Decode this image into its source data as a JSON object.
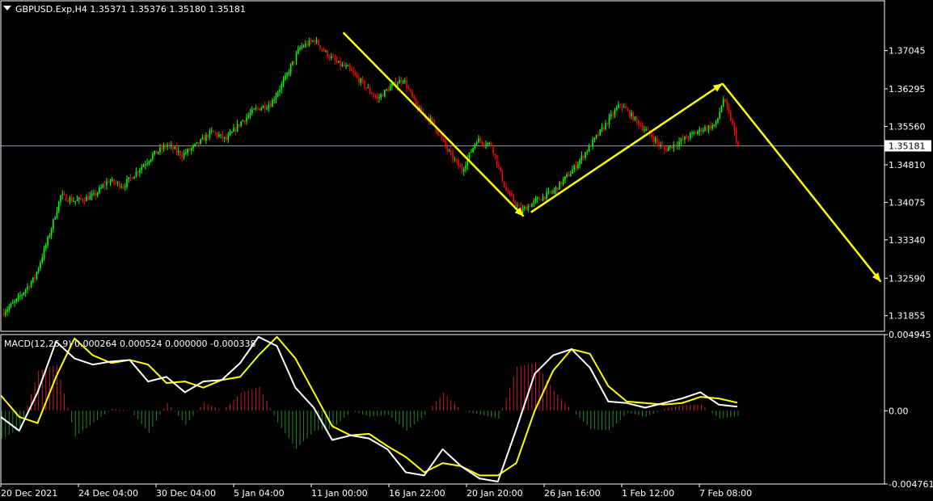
{
  "header": {
    "symbol_line": "GBPUSD.Exp,H4  1.35371 1.35376 1.35180 1.35181",
    "dropdown_icon": "triangle-down-icon"
  },
  "colors": {
    "background": "#000000",
    "bull": "#00ff00",
    "bear": "#ff0000",
    "arrow": "#ffff00",
    "macd": "#ffffff",
    "signal": "#ffff00",
    "hist_pos": "#c81e1e",
    "hist_neg": "#1e8c1e",
    "frame": "#ffffff"
  },
  "chart_data": [
    {
      "type": "candlestick",
      "title": "GBPUSD.Exp,H4",
      "ohlc_last": {
        "open": 1.35371,
        "high": 1.35376,
        "low": 1.3518,
        "close": 1.35181
      },
      "current_price_label": "1.35181",
      "ylim": [
        1.3155,
        1.3802
      ],
      "y_ticks": [
        "1.37045",
        "1.36295",
        "1.35560",
        "1.34810",
        "1.34075",
        "1.33340",
        "1.32590",
        "1.31855"
      ],
      "x_ticks": [
        "20 Dec 2021",
        "24 Dec 04:00",
        "30 Dec 04:00",
        "5 Jan 04:00",
        "11 Jan 00:00",
        "16 Jan 22:00",
        "20 Jan 20:00",
        "26 Jan 16:00",
        "1 Feb 12:00",
        "7 Feb 08:00"
      ],
      "close_path": [
        [
          0,
          1.319
        ],
        [
          8,
          1.3215
        ],
        [
          18,
          1.326
        ],
        [
          26,
          1.3345
        ],
        [
          32,
          1.342
        ],
        [
          40,
          1.341
        ],
        [
          50,
          1.342
        ],
        [
          58,
          1.345
        ],
        [
          66,
          1.344
        ],
        [
          74,
          1.347
        ],
        [
          82,
          1.35
        ],
        [
          90,
          1.352
        ],
        [
          98,
          1.35
        ],
        [
          106,
          1.352
        ],
        [
          114,
          1.3545
        ],
        [
          122,
          1.353
        ],
        [
          130,
          1.3565
        ],
        [
          138,
          1.359
        ],
        [
          146,
          1.36
        ],
        [
          154,
          1.365
        ],
        [
          162,
          1.371
        ],
        [
          170,
          1.3725
        ],
        [
          176,
          1.37
        ],
        [
          182,
          1.368
        ],
        [
          188,
          1.367
        ],
        [
          196,
          1.364
        ],
        [
          204,
          1.361
        ],
        [
          210,
          1.363
        ],
        [
          218,
          1.365
        ],
        [
          226,
          1.359
        ],
        [
          234,
          1.3565
        ],
        [
          242,
          1.351
        ],
        [
          250,
          1.347
        ],
        [
          258,
          1.353
        ],
        [
          266,
          1.352
        ],
        [
          274,
          1.343
        ],
        [
          282,
          1.339
        ],
        [
          290,
          1.341
        ],
        [
          300,
          1.343
        ],
        [
          310,
          1.347
        ],
        [
          320,
          1.352
        ],
        [
          328,
          1.356
        ],
        [
          336,
          1.36
        ],
        [
          344,
          1.357
        ],
        [
          352,
          1.354
        ],
        [
          360,
          1.351
        ],
        [
          370,
          1.353
        ],
        [
          380,
          1.355
        ],
        [
          388,
          1.356
        ],
        [
          392,
          1.361
        ],
        [
          396,
          1.357
        ],
        [
          400,
          1.3518
        ]
      ],
      "annotations": [
        {
          "type": "arrow",
          "from": [
            186,
            1.374
          ],
          "to": [
            284,
            1.338
          ]
        },
        {
          "type": "arrow",
          "from": [
            288,
            1.3388
          ],
          "to": [
            392,
            1.364
          ]
        },
        {
          "type": "arrow",
          "from": [
            392,
            1.364
          ],
          "to": [
            478,
            1.3252
          ]
        }
      ]
    },
    {
      "type": "line",
      "title": "MACD(12,26,9) 0.000264 0.000524 0.000000 -0.000338",
      "ylim": [
        -0.00476,
        0.00495
      ],
      "y_ticks": [
        "0.004945",
        "0.00",
        "-0.004761"
      ],
      "series": [
        {
          "name": "MACD",
          "x": [
            0,
            10,
            20,
            30,
            40,
            50,
            60,
            70,
            80,
            90,
            100,
            110,
            120,
            130,
            140,
            150,
            160,
            170,
            180,
            190,
            200,
            210,
            220,
            230,
            240,
            250,
            260,
            270,
            280,
            290,
            300,
            310,
            320,
            330,
            340,
            350,
            360,
            370,
            380,
            390,
            400
          ],
          "values": [
            -0.0004,
            -0.0013,
            0.0012,
            0.0045,
            0.0034,
            0.003,
            0.0032,
            0.0033,
            0.0019,
            0.0022,
            0.0012,
            0.0019,
            0.002,
            0.0031,
            0.0048,
            0.0042,
            0.0015,
            0.0002,
            -0.0019,
            -0.0016,
            -0.0018,
            -0.0025,
            -0.004,
            -0.0042,
            -0.0025,
            -0.0036,
            -0.0044,
            -0.0046,
            -0.0012,
            0.0024,
            0.0036,
            0.004,
            0.0028,
            0.0006,
            0.0005,
            0.0002,
            0.0005,
            0.0008,
            0.0012,
            0.0004,
            0.000264
          ]
        },
        {
          "name": "Signal",
          "x": [
            0,
            10,
            20,
            30,
            40,
            50,
            60,
            70,
            80,
            90,
            100,
            110,
            120,
            130,
            140,
            150,
            160,
            170,
            180,
            190,
            200,
            210,
            220,
            230,
            240,
            250,
            260,
            270,
            280,
            290,
            300,
            310,
            320,
            330,
            340,
            350,
            360,
            370,
            380,
            390,
            400
          ],
          "values": [
            0.001,
            -0.0004,
            -0.0008,
            0.0022,
            0.0047,
            0.0036,
            0.0031,
            0.0033,
            0.003,
            0.0018,
            0.0019,
            0.0015,
            0.002,
            0.0022,
            0.0036,
            0.0048,
            0.0034,
            0.0012,
            -0.001,
            -0.0016,
            -0.0015,
            -0.0023,
            -0.003,
            -0.004,
            -0.0034,
            -0.0036,
            -0.0042,
            -0.0042,
            -0.0034,
            0.0,
            0.0026,
            0.004,
            0.0037,
            0.0016,
            0.0006,
            0.0005,
            0.0004,
            0.0005,
            0.0009,
            0.0008,
            0.000524
          ]
        }
      ]
    }
  ]
}
